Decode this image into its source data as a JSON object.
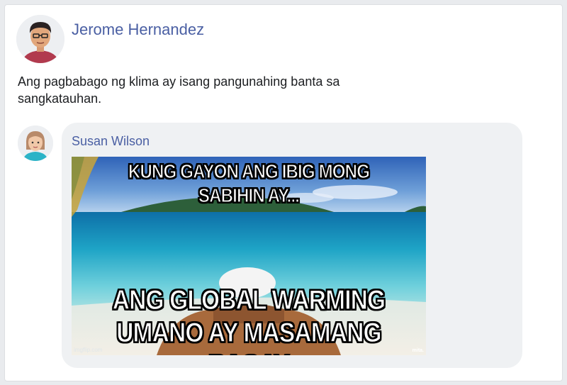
{
  "post": {
    "author_name": "Jerome Hernandez",
    "text": "Ang pagbabago ng klima ay isang pangunahing banta sa sangkatauhan."
  },
  "comment": {
    "author_name": "Susan Wilson",
    "meme": {
      "top_text": "KUNG GAYON ANG IBIG MONG SABIHIN AY...",
      "bottom_text_line1": "ANG GLOBAL WARMING",
      "bottom_text_line2": "UMANO AY MASAMANG BAGAY",
      "watermark": "imgflip.com",
      "corner_mark": "mita."
    }
  },
  "colors": {
    "name_link": "#4a5fa3",
    "bubble": "#eff1f3",
    "sea": "#2fb7cf"
  },
  "icons": {
    "post_avatar": "avatar-man-icon",
    "comment_avatar": "avatar-woman-icon"
  }
}
